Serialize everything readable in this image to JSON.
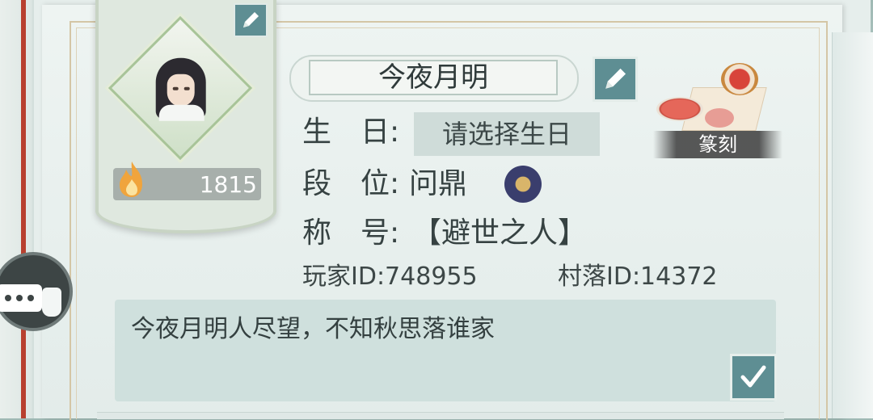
{
  "player": {
    "name": "今夜月明",
    "score": "1815"
  },
  "fields": {
    "birthday_label": "生　日:",
    "birthday_value": "请选择生日",
    "rank_label": "段　位:",
    "rank_value": "问鼎",
    "title_label": "称　号:",
    "title_value": "【避世之人】",
    "player_id": "玩家ID:748955",
    "village_id": "村落ID:14372"
  },
  "signature": {
    "text": "今夜月明人尽望，不知秋思落谁家"
  },
  "seal": {
    "label": "篆刻"
  },
  "icons": {
    "edit": "pencil-icon",
    "confirm": "checkmark-icon",
    "score": "fire-icon",
    "chat": "chat-bubble-icon",
    "rank": "rank-badge-icon"
  },
  "colors": {
    "accent": "#5e8e93",
    "text": "#364242",
    "panel": "#cfe0dd",
    "seal_red": "#d8443a"
  }
}
